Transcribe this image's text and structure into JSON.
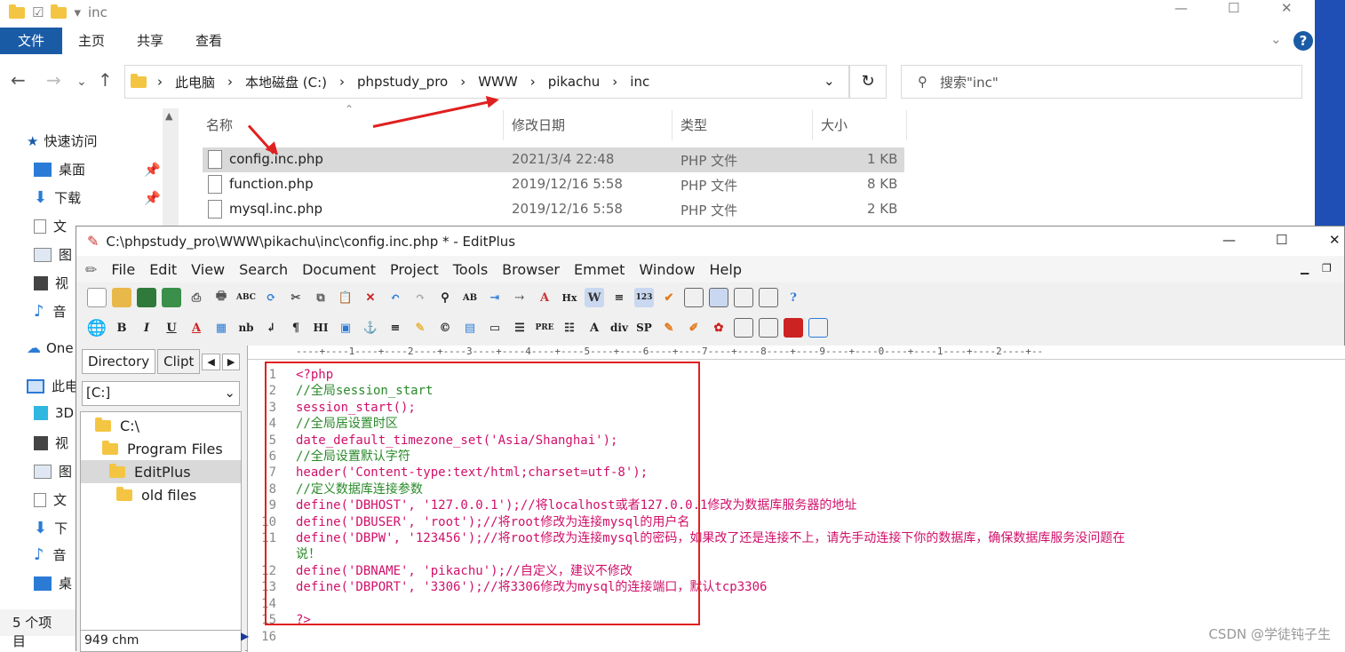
{
  "explorer": {
    "title": "inc",
    "ribbon_tabs": [
      "文件",
      "主页",
      "共享",
      "查看"
    ],
    "breadcrumb": [
      "此电脑",
      "本地磁盘 (C:)",
      "phpstudy_pro",
      "WWW",
      "pikachu",
      "inc"
    ],
    "search_placeholder": "搜索\"inc\"",
    "columns": {
      "name": "名称",
      "date": "修改日期",
      "type": "类型",
      "size": "大小"
    },
    "files": [
      {
        "name": "config.inc.php",
        "date": "2021/3/4 22:48",
        "type": "PHP 文件",
        "size": "1 KB"
      },
      {
        "name": "function.php",
        "date": "2019/12/16 5:58",
        "type": "PHP 文件",
        "size": "8 KB"
      },
      {
        "name": "mysql.inc.php",
        "date": "2019/12/16 5:58",
        "type": "PHP 文件",
        "size": "2 KB"
      }
    ],
    "sidebar": [
      "快速访问",
      "桌面",
      "下载",
      "文",
      "图",
      "视",
      "音",
      "One",
      "此电",
      "3D",
      "视",
      "图",
      "文",
      "下",
      "音",
      "桌"
    ],
    "status": "5 个项目"
  },
  "editplus": {
    "title": "C:\\phpstudy_pro\\WWW\\pikachu\\inc\\config.inc.php * - EditPlus",
    "menu": [
      "File",
      "Edit",
      "View",
      "Search",
      "Document",
      "Project",
      "Tools",
      "Browser",
      "Emmet",
      "Window",
      "Help"
    ],
    "dir_tabs": [
      "Directory",
      "Clipt"
    ],
    "drive": "[C:]",
    "tree": [
      "C:\\",
      "Program Files",
      "EditPlus",
      "old files"
    ],
    "tree_footer": "949 chm",
    "ruler": "----+----1----+----2----+----3----+----4----+----5----+----6----+----7----+----8----+----9----+----0----+----1----+----2----+--",
    "code": [
      "<?php",
      "//全局session_start",
      "session_start();",
      "//全局居设置时区",
      "date_default_timezone_set('Asia/Shanghai');",
      "//全局设置默认字符",
      "header('Content-type:text/html;charset=utf-8');",
      "//定义数据库连接参数",
      "define('DBHOST', '127.0.0.1');//将localhost或者127.0.0.1修改为数据库服务器的地址",
      "define('DBUSER', 'root');//将root修改为连接mysql的用户名",
      "define('DBPW', '123456');//将root修改为连接mysql的密码，如果改了还是连接不上，请先手动连接下你的数据库，确保数据库服务没问题在",
      "说！",
      "define('DBNAME', 'pikachu');//自定义，建议不修改",
      "define('DBPORT', '3306');//将3306修改为mysql的连接端口，默认tcp3306",
      "",
      "?>",
      ""
    ],
    "line_numbers": [
      "1",
      "2",
      "3",
      "4",
      "5",
      "6",
      "7",
      "8",
      "9",
      "10",
      "11",
      "",
      "12",
      "13",
      "14",
      "15",
      "16"
    ]
  },
  "watermark": "CSDN @学徒钝子生"
}
